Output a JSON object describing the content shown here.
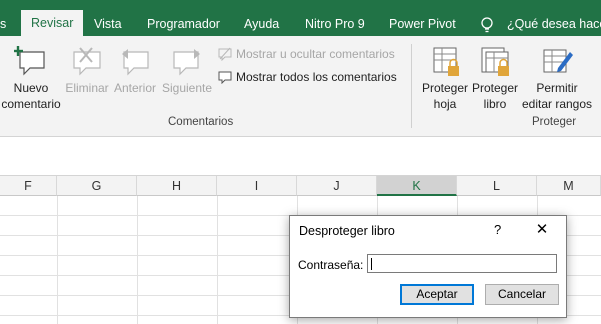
{
  "tabs": [
    {
      "label": "s"
    },
    {
      "label": "Revisar",
      "active": true
    },
    {
      "label": "Vista"
    },
    {
      "label": "Programador"
    },
    {
      "label": "Ayuda"
    },
    {
      "label": "Nitro Pro 9"
    },
    {
      "label": "Power Pivot"
    }
  ],
  "tell_me": "¿Qué desea hacer?",
  "ribbon": {
    "comments_group": {
      "label": "Comentarios",
      "new_comment": [
        "Nuevo",
        "comentario"
      ],
      "delete": "Eliminar",
      "previous": "Anterior",
      "next": "Siguiente",
      "show_hide": "Mostrar u ocultar comentarios",
      "show_all": "Mostrar todos los comentarios"
    },
    "protect_group": {
      "label": "Proteger",
      "protect_sheet": [
        "Proteger",
        "hoja"
      ],
      "protect_workbook": [
        "Proteger",
        "libro"
      ],
      "allow_edit_ranges": [
        "Permitir",
        "editar rangos"
      ]
    }
  },
  "columns": [
    {
      "label": "F"
    },
    {
      "label": "G"
    },
    {
      "label": "H"
    },
    {
      "label": "I"
    },
    {
      "label": "J"
    },
    {
      "label": "K",
      "selected": true
    },
    {
      "label": "L"
    },
    {
      "label": "M"
    }
  ],
  "dialog": {
    "title": "Desproteger libro",
    "help": "?",
    "close": "✕",
    "password_label": "Contraseña:",
    "password_value": "",
    "ok": "Aceptar",
    "cancel": "Cancelar"
  },
  "colors": {
    "accent": "#217346",
    "ribbon_bg": "#f3f3f3",
    "focus": "#0078d7"
  }
}
